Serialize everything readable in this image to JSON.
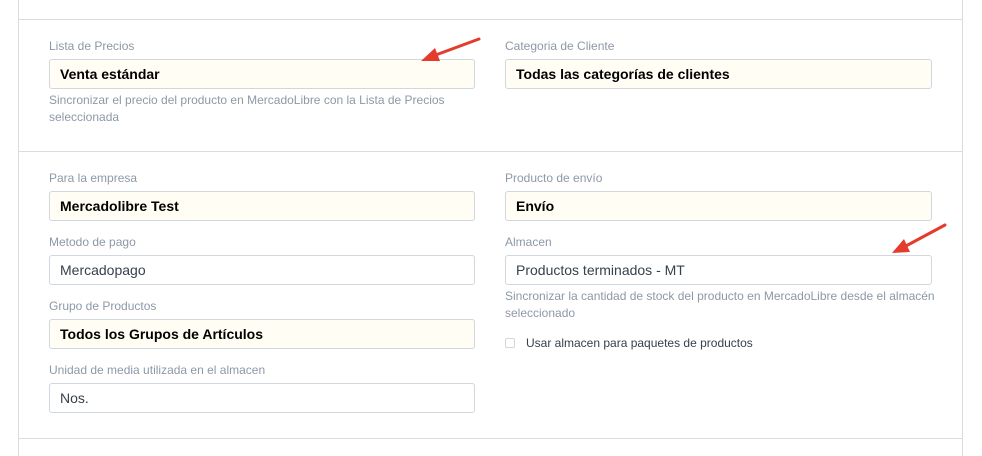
{
  "price_section": {
    "price_list": {
      "label": "Lista de Precios",
      "value": "Venta estándar",
      "help": "Sincronizar el precio del producto en MercadoLibre con la Lista de Precios seleccionada"
    },
    "customer_category": {
      "label": "Categoria de Cliente",
      "value": "Todas las categorías de clientes"
    }
  },
  "company_section": {
    "company": {
      "label": "Para la empresa",
      "value": "Mercadolibre Test"
    },
    "payment_method": {
      "label": "Metodo de pago",
      "value": "Mercadopago"
    },
    "item_group": {
      "label": "Grupo de Productos",
      "value": "Todos los Grupos de Artículos"
    },
    "uom": {
      "label": "Unidad de media utilizada en el almacen",
      "value": "Nos."
    },
    "shipping_item": {
      "label": "Producto de envío",
      "value": "Envío"
    },
    "warehouse": {
      "label": "Almacen",
      "value": "Productos terminados - MT",
      "help": "Sincronizar la cantidad de stock del producto en MercadoLibre desde el almacén seleccionado"
    },
    "bundle_checkbox": {
      "label": "Usar almacen para paquetes de productos",
      "checked": false
    }
  },
  "colors": {
    "annotation_arrow": "#e53b2c",
    "link_field_bg": "#fffdf4",
    "border": "#d1d8dd"
  },
  "icons": {
    "annotation": "red-arrow-icon"
  }
}
